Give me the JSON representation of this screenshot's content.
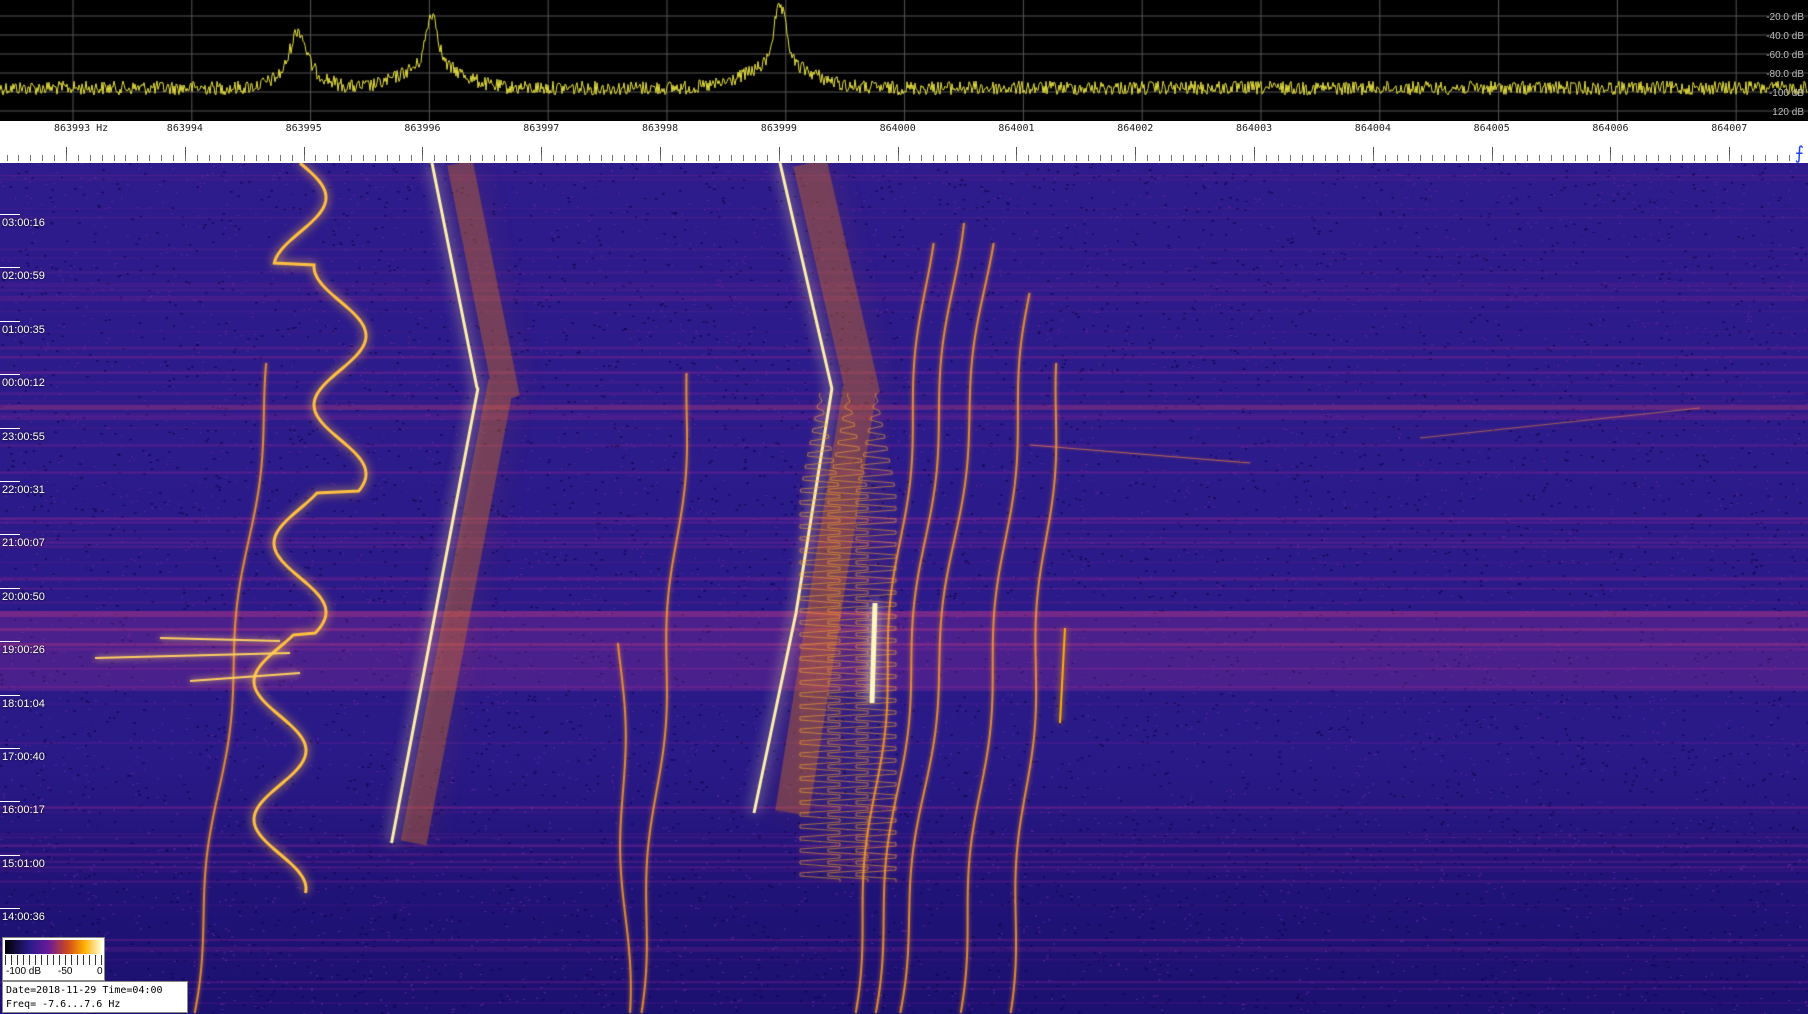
{
  "spectrum": {
    "db_labels": [
      "-20.0 dB",
      "-40.0 dB",
      "-60.0 dB",
      "-80.0 dB",
      "-100 dB",
      "120 dB"
    ]
  },
  "frequency_axis": {
    "labels": [
      "863993 Hz",
      "863994",
      "863995",
      "863996",
      "863997",
      "863998",
      "863999",
      "864000",
      "864001",
      "864002",
      "864003",
      "864004",
      "864005",
      "864006",
      "864007"
    ]
  },
  "time_axis": {
    "labels": [
      "03:00:16",
      "02:00:59",
      "01:00:35",
      "00:00:12",
      "23:00:55",
      "22:00:31",
      "21:00:07",
      "20:00:50",
      "19:00:26",
      "18:01:04",
      "17:00:40",
      "16:00:17",
      "15:01:00",
      "14:00:36"
    ]
  },
  "legend": {
    "min_label": "-100 dB",
    "mid_label": "-50",
    "max_label": "0"
  },
  "info": {
    "date_line": "Date=2018-11-29 Time=04:00",
    "freq_line": "Freq= -7.6...7.6 Hz"
  },
  "colors": {
    "waterfall_bg": "#2a1a8a",
    "signal_hot": "#ffb000",
    "spectrum_trace": "#e6e040",
    "ruler_icon": "#1e40ff"
  }
}
